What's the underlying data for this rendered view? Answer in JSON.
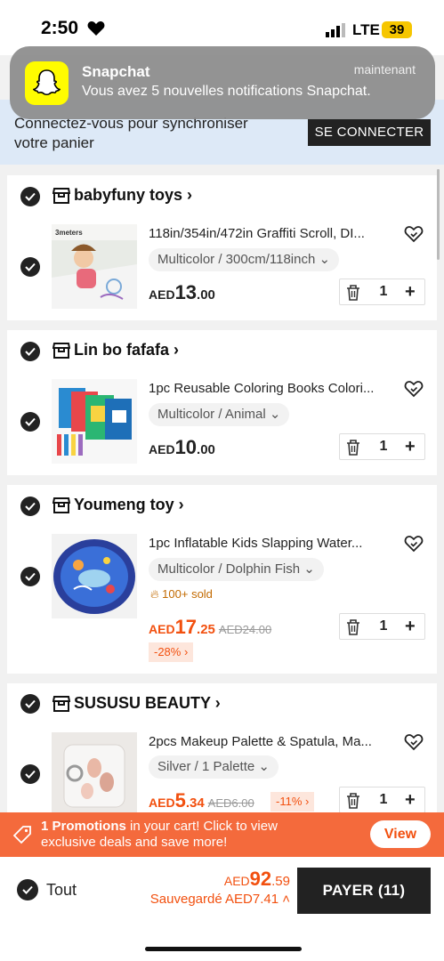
{
  "status": {
    "time": "2:50",
    "network": "LTE",
    "battery": "39"
  },
  "notification": {
    "app": "Snapchat",
    "time": "maintenant",
    "message": "Vous avez 5 nouvelles notifications Snapchat."
  },
  "login": {
    "text": "Connectez-vous pour synchroniser votre panier",
    "button": "SE CONNECTER"
  },
  "stores": [
    {
      "name": "babyfuny toys",
      "item": {
        "title": "118in/354in/472in Graffiti Scroll, DI...",
        "variant": "Multicolor / 300cm/118inch",
        "currency": "AED",
        "price_int": "13",
        "price_dec": ".00",
        "qty": "1"
      }
    },
    {
      "name": "Lin bo fafafa",
      "item": {
        "title": "1pc Reusable Coloring Books Colori...",
        "variant": "Multicolor / Animal",
        "currency": "AED",
        "price_int": "10",
        "price_dec": ".00",
        "qty": "1"
      }
    },
    {
      "name": "Youmeng toy",
      "item": {
        "title": "1pc Inflatable Kids Slapping Water...",
        "variant": "Multicolor / Dolphin Fish",
        "sold": "100+ sold",
        "currency": "AED",
        "price_int": "17",
        "price_dec": ".25",
        "old_price": "AED24.00",
        "discount": "-28%",
        "qty": "1"
      }
    },
    {
      "name": "SUSUSU BEAUTY",
      "item": {
        "title": "2pcs Makeup Palette & Spatula, Ma...",
        "variant": "Silver / 1 Palette",
        "currency": "AED",
        "price_int": "5",
        "price_dec": ".34",
        "old_price": "AED6.00",
        "discount": "-11%",
        "qty": "1"
      }
    }
  ],
  "promo": {
    "bold": "1 Promotions",
    "text": " in your cart! Click to view exclusive deals and save more!",
    "button": "View"
  },
  "footer": {
    "all_label": "Tout",
    "currency": "AED",
    "total_int": "92",
    "total_dec": ".59",
    "saved": "Sauvegardé AED7.41",
    "pay_button": "PAYER (11)"
  },
  "colors": {
    "accent": "#f2500f",
    "dark": "#222222",
    "banner": "#dde9f7"
  }
}
